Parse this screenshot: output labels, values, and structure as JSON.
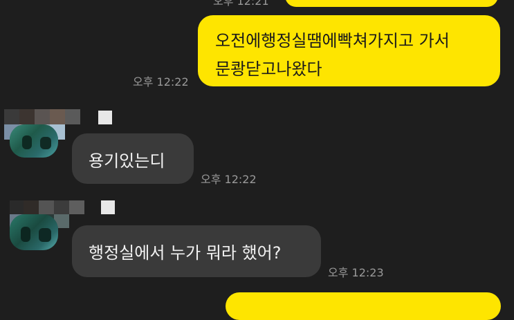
{
  "colors": {
    "background": "#1e1e1e",
    "outgoing_bubble": "#fee500",
    "incoming_bubble": "#3a3a3a",
    "timestamp": "#9a9a9a"
  },
  "messages": {
    "top_partial_time": "오후 12:21",
    "out1": {
      "line1": "오전에행정실땜에빡쳐가지고 가서",
      "line2": "문쾅닫고나왔다",
      "time": "오후 12:22"
    },
    "in1": {
      "text": "용기있는디",
      "time": "오후 12:22"
    },
    "in2": {
      "text": "행정실에서 누가 뭐라 했어?",
      "time": "오후 12:23"
    }
  }
}
